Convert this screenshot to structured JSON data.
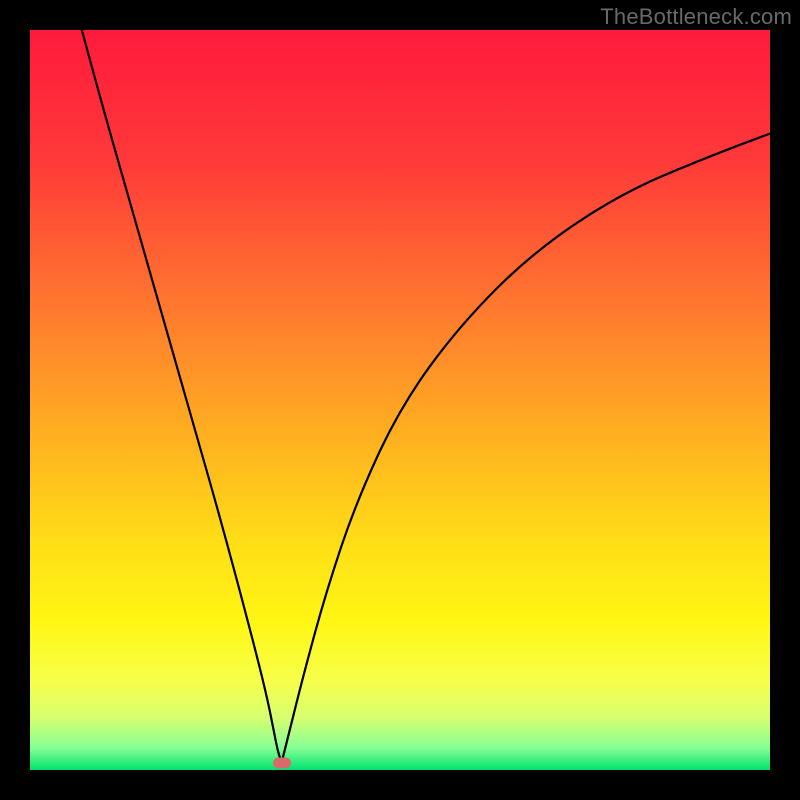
{
  "watermark": "TheBottleneck.com",
  "colors": {
    "background": "#000000",
    "gradient_stops": [
      {
        "pct": 0,
        "color": "#ff1a3c"
      },
      {
        "pct": 18,
        "color": "#ff3a39"
      },
      {
        "pct": 38,
        "color": "#ff7a2e"
      },
      {
        "pct": 55,
        "color": "#ffb020"
      },
      {
        "pct": 70,
        "color": "#ffe016"
      },
      {
        "pct": 80,
        "color": "#fff614"
      },
      {
        "pct": 88,
        "color": "#f7ff4a"
      },
      {
        "pct": 93,
        "color": "#d6ff70"
      },
      {
        "pct": 97,
        "color": "#86ff94"
      },
      {
        "pct": 100,
        "color": "#00e36e"
      }
    ],
    "curve": "#000000",
    "marker": "#d96a6a",
    "watermark": "#67696b"
  },
  "chart_data": {
    "type": "line",
    "title": "",
    "xlabel": "",
    "ylabel": "",
    "xlim": [
      0,
      100
    ],
    "ylim": [
      0,
      100
    ],
    "annotations": [
      {
        "name": "marker",
        "x": 34,
        "y": 1
      },
      {
        "name": "watermark",
        "text": "TheBottleneck.com"
      }
    ],
    "series": [
      {
        "name": "left-branch",
        "x": [
          7,
          10,
          14,
          18,
          22,
          26,
          30,
          32,
          33,
          33.5,
          34
        ],
        "values": [
          100,
          89,
          75,
          61,
          47,
          33,
          18,
          10,
          5,
          2.5,
          1
        ]
      },
      {
        "name": "right-branch",
        "x": [
          34,
          35,
          37,
          40,
          44,
          50,
          58,
          68,
          80,
          92,
          100
        ],
        "values": [
          1,
          5,
          13,
          24,
          36,
          49,
          60,
          70,
          78,
          83,
          86
        ]
      }
    ]
  }
}
